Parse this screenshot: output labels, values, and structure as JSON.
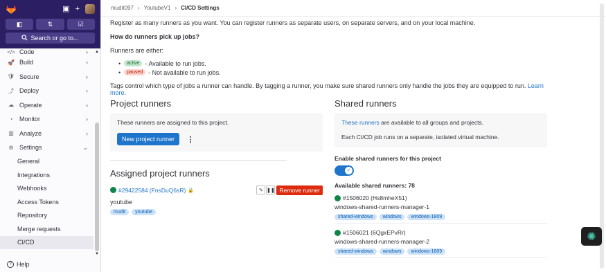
{
  "sidebar": {
    "top_icons": {
      "panel": "▣",
      "plus": "+"
    },
    "shortcuts": [
      "◧",
      "⇅",
      "☑"
    ],
    "search_label": "Search or go to...",
    "nav": [
      {
        "icon": "</>",
        "label": "Code"
      },
      {
        "icon": "🚀",
        "label": "Build"
      },
      {
        "icon": "🛡",
        "label": "Secure"
      },
      {
        "icon": "⤴",
        "label": "Deploy"
      },
      {
        "icon": "☁",
        "label": "Operate"
      },
      {
        "icon": "◔",
        "label": "Monitor"
      },
      {
        "icon": "▥",
        "label": "Analyze"
      },
      {
        "icon": "⚙",
        "label": "Settings"
      }
    ],
    "settings_sub": [
      "General",
      "Integrations",
      "Webhooks",
      "Access Tokens",
      "Repository",
      "Merge requests",
      "CI/CD"
    ],
    "help_label": "Help"
  },
  "breadcrumbs": [
    "mudit097",
    "YoutubeV1",
    "CI/CD Settings"
  ],
  "intro": "Register as many runners as you want. You can register runners as separate users, on separate servers, and on your local machine.",
  "how_heading": "How do runners pick up jobs?",
  "runners_either": "Runners are either:",
  "states": [
    {
      "badge": "active",
      "text": "- Available to run jobs."
    },
    {
      "badge": "paused",
      "text": "- Not available to run jobs."
    }
  ],
  "tags_text": "Tags control which type of jobs a runner can handle. By tagging a runner, you make sure shared runners only handle the jobs they are equipped to run.",
  "learn_more": "Learn more.",
  "project_runners": {
    "title": "Project runners",
    "info": "These runners are assigned to this project.",
    "new_button": "New project runner",
    "assigned_title": "Assigned project runners",
    "runner": {
      "id": "#29422584 (FnsDuQ6sR)",
      "description": "youtube",
      "tags": [
        "mudit",
        "youtube"
      ],
      "remove_label": "Remove runner"
    }
  },
  "shared_runners": {
    "title": "Shared runners",
    "info_link": "These runners",
    "info_rest": " are available to all groups and projects.",
    "info2": "Each CI/CD job runs on a separate, isolated virtual machine.",
    "enable_label": "Enable shared runners for this project",
    "available": "Available shared runners: 78",
    "runners": [
      {
        "id": "#1506020 (Hs8mheX51)",
        "description": "windows-shared-runners-manager-1",
        "tags": [
          "shared-windows",
          "windows",
          "windows-1809"
        ]
      },
      {
        "id": "#1506021 (6QgxEPvRr)",
        "description": "windows-shared-runners-manager-2",
        "tags": [
          "shared-windows",
          "windows",
          "windows-1809"
        ]
      }
    ]
  },
  "colors": {
    "primary": "#1f75cb",
    "danger": "#dd2b0e",
    "sidebar_top": "#2c1e63",
    "online": "#108548"
  }
}
